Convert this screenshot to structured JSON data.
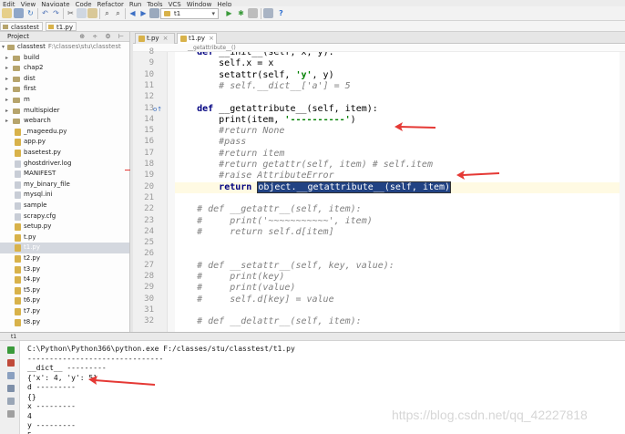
{
  "menu": [
    "Edit",
    "View",
    "Navigate",
    "Code",
    "Refactor",
    "Run",
    "Tools",
    "VCS",
    "Window",
    "Help"
  ],
  "toolbar": {
    "run_config": "t1",
    "icons": [
      "open-folder-icon",
      "save-icon",
      "sync-icon",
      "undo-icon",
      "redo-icon",
      "cut-icon",
      "copy-icon",
      "paste-icon",
      "find-icon",
      "replace-icon",
      "back-icon",
      "forward-icon",
      "build-icon",
      "run-icon",
      "debug-icon",
      "stop-icon",
      "project-structure-icon",
      "help-icon"
    ],
    "help_label": "?"
  },
  "navbar": {
    "crumbs": [
      "classtest",
      "t1.py"
    ]
  },
  "project": {
    "header": "Project",
    "root_name": "classtest",
    "root_path": "F:\\classes\\stu\\classtest",
    "folders": [
      "build",
      "chap2",
      "dist",
      "first",
      "m",
      "multispider",
      "webarch"
    ],
    "files": [
      "_mageedu.py",
      "app.py",
      "basetest.py",
      "ghostdriver.log",
      "MANIFEST",
      "my_binary_file",
      "mysql.ini",
      "sample",
      "scrapy.cfg",
      "setup.py",
      "t.py",
      "t1.py",
      "t2.py",
      "t3.py",
      "t4.py",
      "t5.py",
      "t6.py",
      "t7.py",
      "t8.py"
    ],
    "selected": "t1.py"
  },
  "editor": {
    "tabs": [
      "t.py",
      "t1.py"
    ],
    "active_tab": "t1.py",
    "tab_close": "×",
    "breadcrumb": "__getattribute__()",
    "lines": [
      {
        "n": "8",
        "text": "    def __init__(self, x, y):"
      },
      {
        "n": "9",
        "text": "        self.x = x"
      },
      {
        "n": "10",
        "text": "        setattr(self, 'y', y)"
      },
      {
        "n": "11",
        "text": "        # self.__dict__['a'] = 5"
      },
      {
        "n": "12",
        "text": ""
      },
      {
        "n": "13",
        "text": "    def __getattribute__(self, item):"
      },
      {
        "n": "14",
        "text": "        print(item, '----------')"
      },
      {
        "n": "15",
        "text": "        #return None"
      },
      {
        "n": "16",
        "text": "        #pass"
      },
      {
        "n": "17",
        "text": "        #return item"
      },
      {
        "n": "18",
        "text": "        #return getattr(self, item) # self.item"
      },
      {
        "n": "19",
        "text": "        #raise AttributeError"
      },
      {
        "n": "20",
        "text": "        return object.__getattribute__(self, item)"
      },
      {
        "n": "21",
        "text": ""
      },
      {
        "n": "22",
        "text": "    # def __getattr__(self, item):"
      },
      {
        "n": "23",
        "text": "    #     print('~~~~~~~~~~~', item)"
      },
      {
        "n": "24",
        "text": "    #     return self.d[item]"
      },
      {
        "n": "25",
        "text": ""
      },
      {
        "n": "26",
        "text": ""
      },
      {
        "n": "27",
        "text": "    # def __setattr__(self, key, value):"
      },
      {
        "n": "28",
        "text": "    #     print(key)"
      },
      {
        "n": "29",
        "text": "    #     print(value)"
      },
      {
        "n": "30",
        "text": "    #     self.d[key] = value"
      },
      {
        "n": "31",
        "text": ""
      },
      {
        "n": "32",
        "text": "    # def __delattr__(self, item):"
      }
    ]
  },
  "run": {
    "tab": "t1",
    "output": [
      "C:\\Python\\Python366\\python.exe F:/classes/stu/classtest/t1.py",
      "-------------------------------",
      "__dict__ ---------",
      "{'x': 4, 'y': 5}",
      "d ---------",
      "{}",
      "x ---------",
      "4",
      "y ---------",
      "5"
    ]
  },
  "watermark": "https://blog.csdn.net/qq_42227818",
  "colors": {
    "keyword": "#000080",
    "string": "#008000",
    "comment": "#808080",
    "selection": "#214283",
    "arrow": "#e53935"
  }
}
